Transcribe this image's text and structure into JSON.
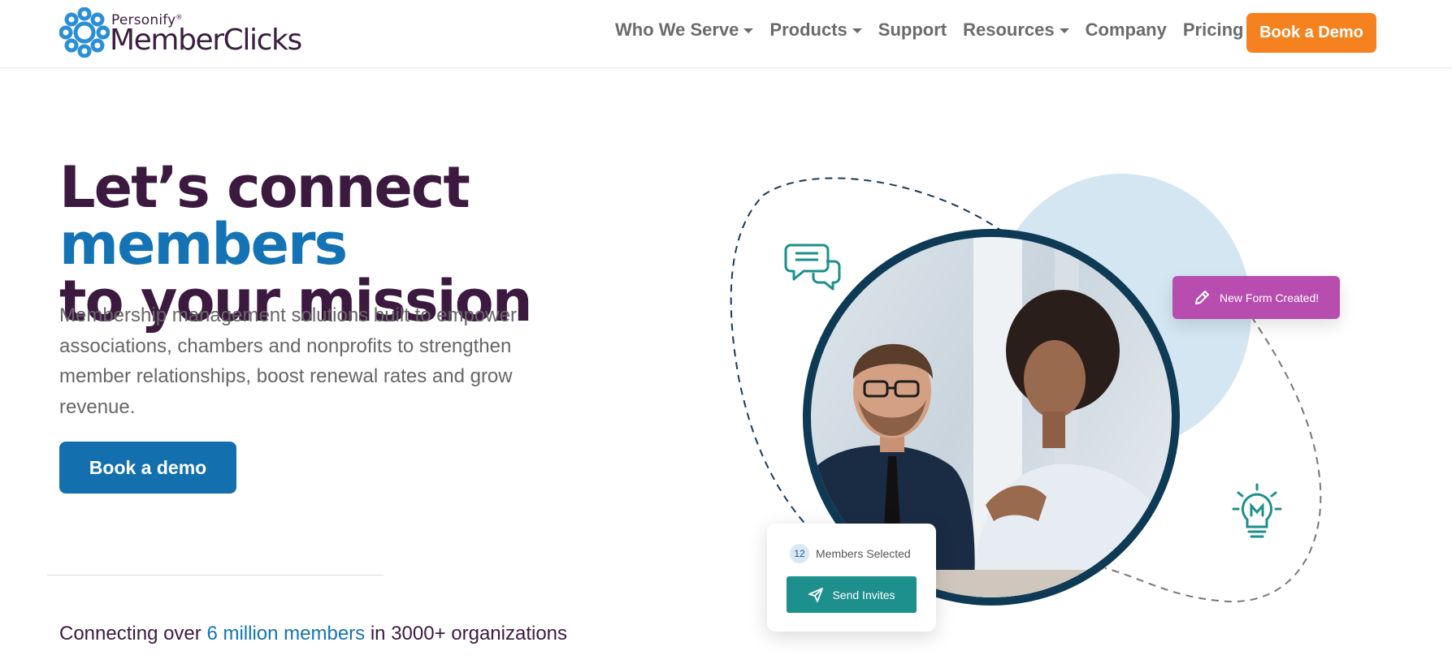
{
  "header": {
    "logo": {
      "brand_small": "Personify",
      "brand_mark": "®",
      "brand_main": "MemberClicks"
    },
    "nav": [
      {
        "label": "Who We Serve",
        "dropdown": true
      },
      {
        "label": "Products",
        "dropdown": true
      },
      {
        "label": "Support",
        "dropdown": false
      },
      {
        "label": "Resources",
        "dropdown": true
      },
      {
        "label": "Company",
        "dropdown": false
      },
      {
        "label": "Pricing",
        "dropdown": true
      }
    ],
    "cta_label": "Book a Demo"
  },
  "hero": {
    "title_part1": "Let’s connect ",
    "title_accent": "members",
    "title_part2": "to your mission",
    "description": "Membership management solutions built to empower associations, chambers and nonprofits to strengthen member relationships, boost renewal rates and grow revenue.",
    "cta_label": "Book a demo"
  },
  "stats": {
    "prefix": "Connecting over ",
    "highlight": "6 million members",
    "middle": " in ",
    "bold_count": "3000+",
    "suffix": " organizations"
  },
  "illustration": {
    "form_badge": "New Form Created!",
    "members_count": "12",
    "members_label": "Members Selected",
    "send_label": "Send Invites",
    "icons": [
      "chat-bubbles-icon",
      "lightbulb-icon",
      "pencil-icon",
      "paper-plane-icon"
    ]
  },
  "colors": {
    "brand_purple": "#3c1a40",
    "accent_blue": "#1373b4",
    "orange": "#f5821f",
    "teal": "#1d8f8d",
    "magenta": "#b84db0"
  }
}
